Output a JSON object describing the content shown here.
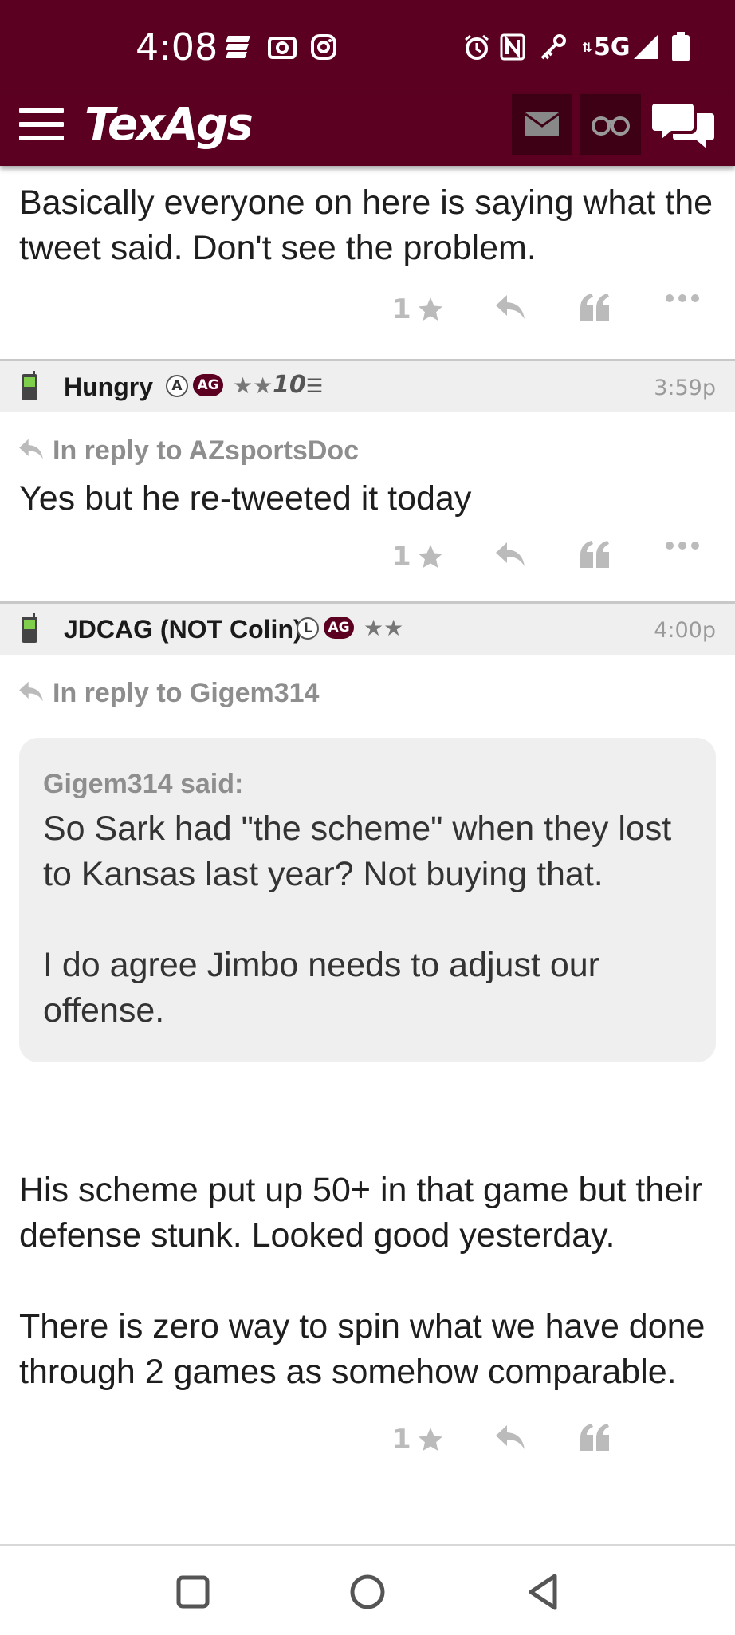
{
  "status_bar": {
    "time": "4:08",
    "left_icons": [
      "news-icon",
      "camera-icon",
      "instagram-icon"
    ],
    "network": "5G",
    "right_icons": [
      "alarm-icon",
      "nfc-icon",
      "key-icon",
      "signal-icon",
      "battery-icon"
    ]
  },
  "app_bar": {
    "logo": "TexAgs",
    "buttons": [
      "mail-icon",
      "binoculars-icon",
      "chat-icon"
    ]
  },
  "posts": [
    {
      "id": "post-top",
      "body": "Basically everyone on here is saying what the tweet said. Don't see the problem.",
      "likes": "1"
    },
    {
      "id": "post-hungry",
      "username": "Hungry",
      "badge_letter": "A",
      "badge_ag": "AG",
      "stars": "★★",
      "rank_label": "10",
      "time": "3:59p",
      "reply_to": "In reply to AZsportsDoc",
      "body": "Yes but he re-tweeted it today",
      "likes": "1"
    },
    {
      "id": "post-jdcag",
      "username": "JDCAG (NOT Colin)",
      "badge_letter": "L",
      "badge_ag": "AG",
      "stars": "★★",
      "time": "4:00p",
      "reply_to": "In reply to Gigem314",
      "quote_author": "Gigem314 said:",
      "quote_text": "So Sark had \"the scheme\" when they lost to Kansas last year? Not buying that.\n\nI do agree Jimbo needs to adjust our offense.",
      "body_p1": "His scheme put up 50+ in that game but their defense stunk. Looked good yesterday.",
      "body_p2": "There is zero way to spin what we have done through 2 games as somehow comparable.",
      "likes": "1"
    }
  ],
  "colors": {
    "brand": "#5b0021",
    "brand_dark": "#3e0015",
    "header_bg": "#efefef",
    "muted": "#bbbbbb"
  },
  "nav_bar": [
    "recents-square-icon",
    "home-circle-icon",
    "back-triangle-icon"
  ]
}
